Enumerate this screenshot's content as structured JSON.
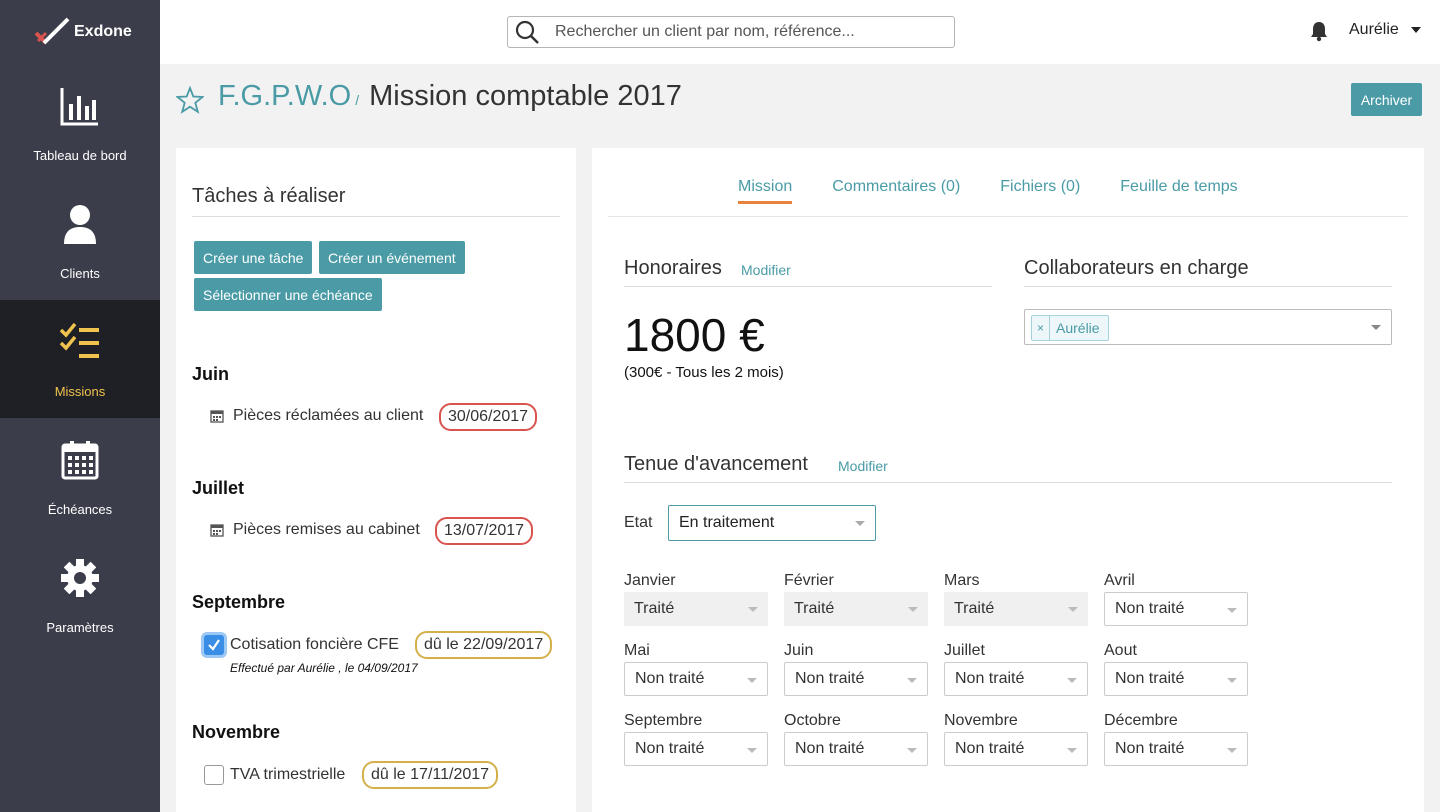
{
  "brand": {
    "name": "Exdone"
  },
  "sidebar": {
    "items": [
      {
        "label": "Tableau de bord",
        "icon": "bar-chart-icon",
        "active": false
      },
      {
        "label": "Clients",
        "icon": "user-icon",
        "active": false
      },
      {
        "label": "Missions",
        "icon": "checklist-icon",
        "active": true
      },
      {
        "label": "Échéances",
        "icon": "calendar-icon",
        "active": false
      },
      {
        "label": "Paramètres",
        "icon": "gear-icon",
        "active": false
      }
    ]
  },
  "topbar": {
    "search_placeholder": "Rechercher un client par nom, référence...",
    "user_name": "Aurélie"
  },
  "header": {
    "client": "F.G.P.W.O",
    "separator": "/",
    "title": "Mission comptable 2017",
    "archive_label": "Archiver"
  },
  "tasks_panel": {
    "title": "Tâches à réaliser",
    "buttons": {
      "create_task": "Créer une tâche",
      "create_event": "Créer un événement",
      "select_deadline": "Sélectionner une échéance"
    },
    "groups": [
      {
        "month": "Juin",
        "task": "Pièces réclamées au client",
        "date": "30/06/2017"
      },
      {
        "month": "Juillet",
        "task": "Pièces remises au cabinet",
        "date": "13/07/2017"
      },
      {
        "month": "Septembre",
        "task": "Cotisation foncière CFE",
        "date": "dû le 22/09/2017",
        "done": true,
        "note": "Effectué par Aurélie , le 04/09/2017"
      },
      {
        "month": "Novembre",
        "task": "TVA trimestrielle",
        "date": "dû le 17/11/2017",
        "done": false
      }
    ]
  },
  "tabs": [
    {
      "label": "Mission",
      "active": true
    },
    {
      "label": "Commentaires (0)",
      "active": false
    },
    {
      "label": "Fichiers (0)",
      "active": false
    },
    {
      "label": "Feuille de temps",
      "active": false
    }
  ],
  "fees": {
    "title": "Honoraires",
    "modify": "Modifier",
    "amount": "1800 €",
    "note": "(300€ - Tous les 2 mois)"
  },
  "collaborators": {
    "title": "Collaborateurs en charge",
    "chip_remove": "×",
    "chips": [
      "Aurélie"
    ]
  },
  "progress": {
    "title": "Tenue d'avancement",
    "modify": "Modifier",
    "state_label": "Etat",
    "state_value": "En traitement",
    "months": [
      {
        "label": "Janvier",
        "value": "Traité"
      },
      {
        "label": "Février",
        "value": "Traité"
      },
      {
        "label": "Mars",
        "value": "Traité"
      },
      {
        "label": "Avril",
        "value": "Non traité"
      },
      {
        "label": "Mai",
        "value": "Non traité"
      },
      {
        "label": "Juin",
        "value": "Non traité"
      },
      {
        "label": "Juillet",
        "value": "Non traité"
      },
      {
        "label": "Aout",
        "value": "Non traité"
      },
      {
        "label": "Septembre",
        "value": "Non traité"
      },
      {
        "label": "Octobre",
        "value": "Non traité"
      },
      {
        "label": "Novembre",
        "value": "Non traité"
      },
      {
        "label": "Décembre",
        "value": "Non traité"
      }
    ]
  },
  "colors": {
    "accent": "#4a9ba6",
    "sidebar": "#3b3e4a",
    "sidebar_active": "#1f2026",
    "active_label": "#f0c34e",
    "tab_underline": "#e8823c"
  }
}
